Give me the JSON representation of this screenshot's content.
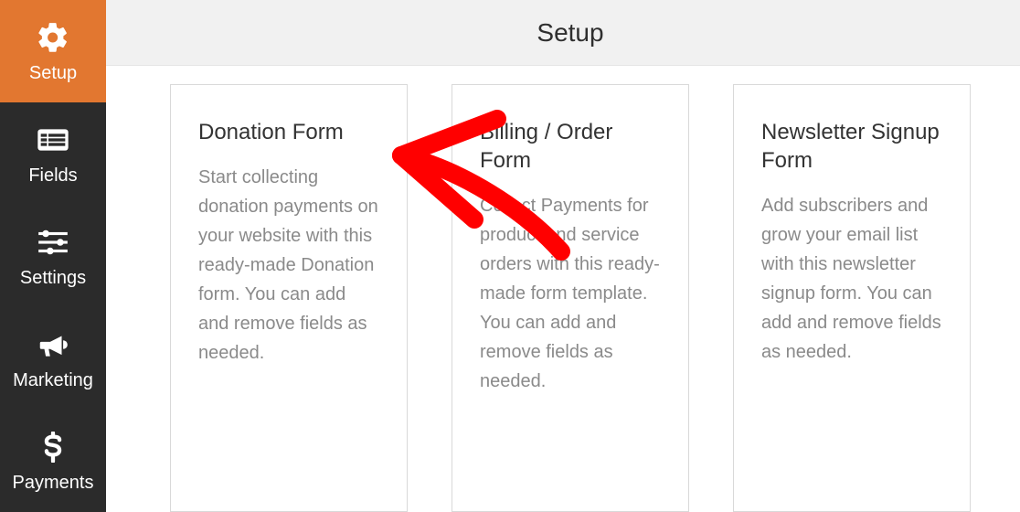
{
  "header": {
    "title": "Setup"
  },
  "sidebar": {
    "items": [
      {
        "label": "Setup"
      },
      {
        "label": "Fields"
      },
      {
        "label": "Settings"
      },
      {
        "label": "Marketing"
      },
      {
        "label": "Payments"
      }
    ]
  },
  "cards": [
    {
      "title": "Donation Form",
      "desc": "Start collecting donation payments on your website with this ready-made Donation form. You can add and remove fields as needed."
    },
    {
      "title": "Billing / Order Form",
      "desc": "Collect Payments for product and service orders with this ready-made form template. You can add and remove fields as needed."
    },
    {
      "title": "Newsletter Signup Form",
      "desc": "Add subscribers and grow your email list with this newsletter signup form. You can add and remove fields as needed."
    }
  ]
}
